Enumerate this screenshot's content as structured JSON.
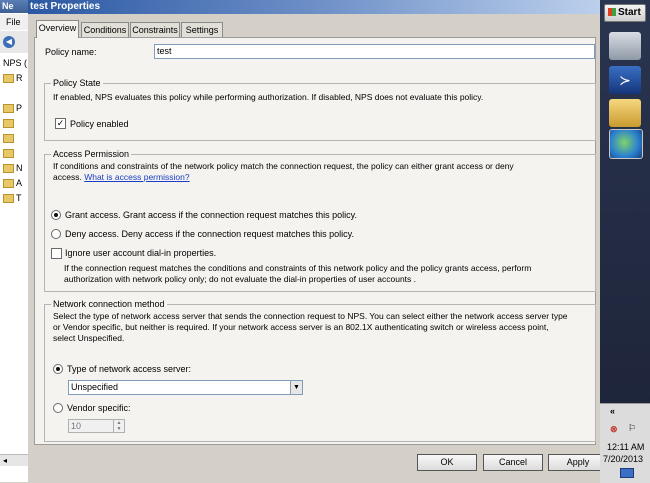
{
  "background_app": {
    "title": "Ne",
    "menu_file": "File",
    "tree": [
      "NPS (",
      "R",
      "",
      "P",
      "",
      "",
      "",
      "N",
      "A",
      "T"
    ]
  },
  "dialog": {
    "title": "test Properties",
    "tabs": [
      "Overview",
      "Conditions",
      "Constraints",
      "Settings"
    ],
    "active_tab": "Overview",
    "policy_name_label": "Policy name:",
    "policy_name_value": "test",
    "policy_state": {
      "legend": "Policy State",
      "description": "If enabled, NPS evaluates this policy while performing authorization. If disabled, NPS does not evaluate this policy.",
      "enabled_label": "Policy enabled",
      "enabled_checked": true
    },
    "access_permission": {
      "legend": "Access Permission",
      "description_line1": "If conditions and constraints of the network policy match the connection request, the policy can either grant access or deny",
      "description_line2": "access.",
      "help_link": "What is access permission?",
      "grant_label": "Grant access. Grant access if the connection request matches this policy.",
      "deny_label": "Deny access. Deny access if the connection request matches this policy.",
      "selected": "grant",
      "ignore_label": "Ignore user account dial-in properties.",
      "ignore_checked": false,
      "ignore_note_line1": "If the connection request matches the conditions and constraints of this network policy and the policy grants access, perform",
      "ignore_note_line2": "authorization with network policy only; do not evaluate the dial-in properties of user accounts ."
    },
    "network_connection": {
      "legend": "Network connection method",
      "description_line1": "Select the type of network access server that sends the connection request to NPS. You can select either the network access server type",
      "description_line2": "or Vendor specific, but neither is required.  If your network access server is an 802.1X authenticating switch or wireless access point,",
      "description_line3": "select Unspecified.",
      "type_label": "Type of network access server:",
      "type_value": "Unspecified",
      "vendor_label": "Vendor specific:",
      "vendor_value": "10",
      "selected": "type"
    },
    "buttons": {
      "ok": "OK",
      "cancel": "Cancel",
      "apply": "Apply"
    }
  },
  "taskbar": {
    "start_label": "Start",
    "tray_chevron": "«",
    "time": "12:11 AM",
    "date": "7/20/2013"
  }
}
